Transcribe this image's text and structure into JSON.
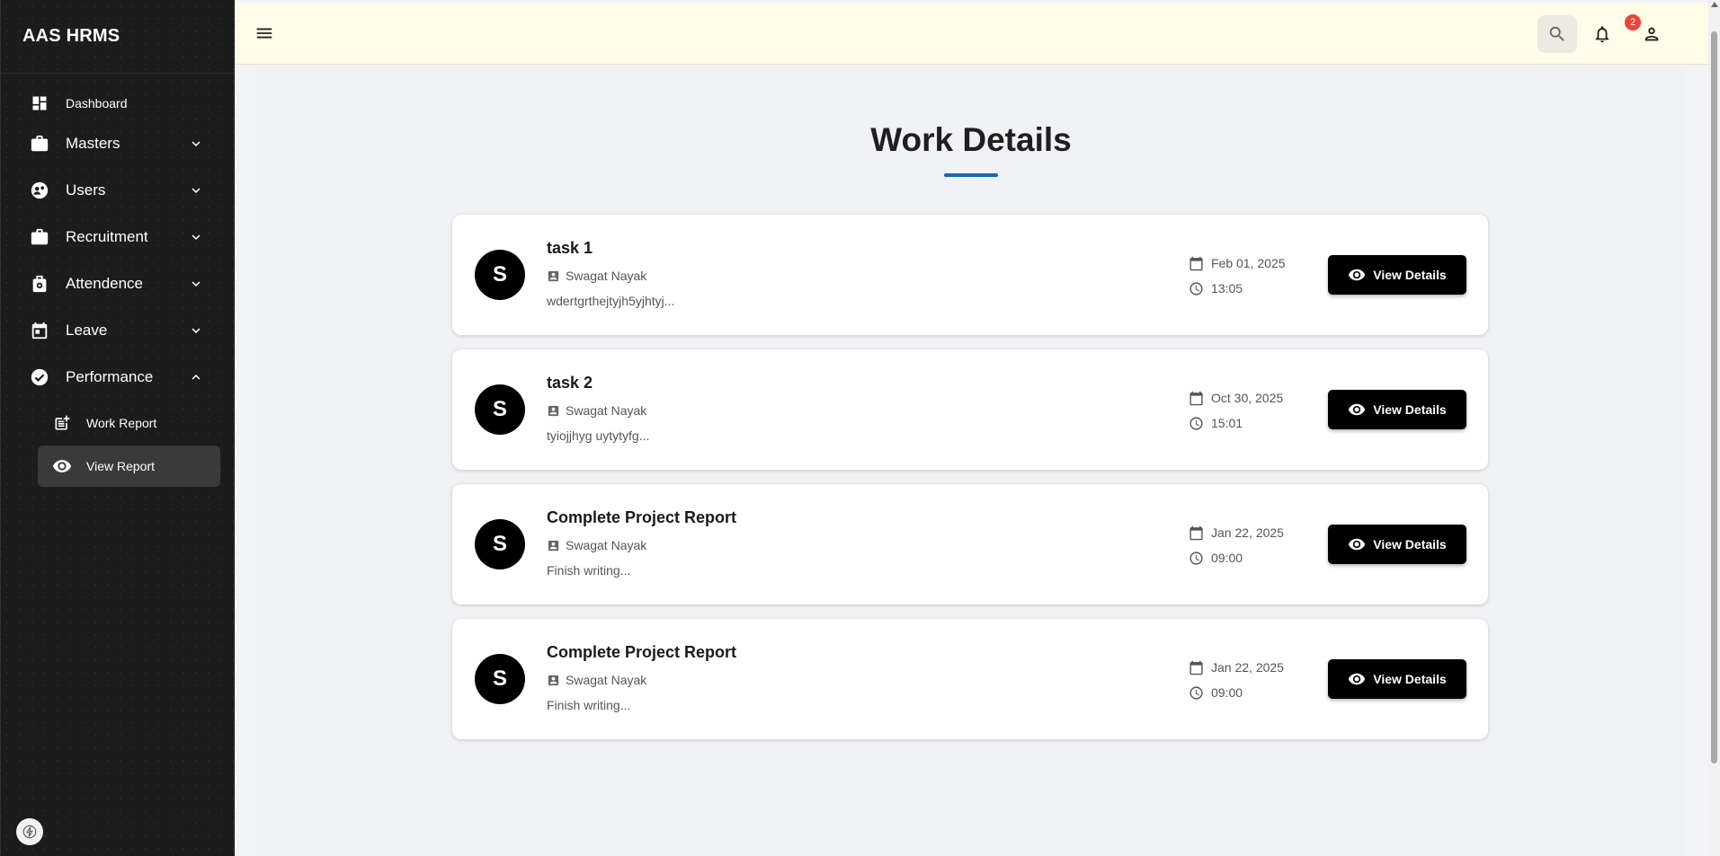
{
  "app": {
    "title": "AAS HRMS"
  },
  "sidebar": {
    "items": [
      {
        "label": "Dashboard",
        "icon": "dashboard-icon"
      },
      {
        "label": "Masters",
        "icon": "briefcase-icon"
      },
      {
        "label": "Users",
        "icon": "users-icon"
      },
      {
        "label": "Recruitment",
        "icon": "briefcase-icon"
      },
      {
        "label": "Attendence",
        "icon": "attendance-icon"
      },
      {
        "label": "Leave",
        "icon": "calendar-icon"
      },
      {
        "label": "Performance",
        "icon": "check-circle-icon"
      }
    ],
    "performance_sub": [
      {
        "label": "Work Report",
        "icon": "post-add-icon"
      },
      {
        "label": "View Report",
        "icon": "eye-icon",
        "active": true
      }
    ]
  },
  "header": {
    "notification_count": "2"
  },
  "main": {
    "title": "Work Details",
    "cards": [
      {
        "avatar": "S",
        "title": "task 1",
        "assignee": "Swagat Nayak",
        "description": "wdertgrthejtyjh5yjhtyj...",
        "date": "Feb 01, 2025",
        "time": "13:05",
        "button": "View Details"
      },
      {
        "avatar": "S",
        "title": "task 2",
        "assignee": "Swagat Nayak",
        "description": "tyiojjhyg uytytyfg...",
        "date": "Oct 30, 2025",
        "time": "15:01",
        "button": "View Details"
      },
      {
        "avatar": "S",
        "title": "Complete Project Report",
        "assignee": "Swagat Nayak",
        "description": "Finish writing...",
        "date": "Jan 22, 2025",
        "time": "09:00",
        "button": "View Details"
      },
      {
        "avatar": "S",
        "title": "Complete Project Report",
        "assignee": "Swagat Nayak",
        "description": "Finish writing...",
        "date": "Jan 22, 2025",
        "time": "09:00",
        "button": "View Details"
      }
    ]
  },
  "colors": {
    "accent": "#1565c0",
    "sidebar_bg": "#1c1c1c",
    "topbar_bg": "#fffde8",
    "badge": "#f04438"
  }
}
